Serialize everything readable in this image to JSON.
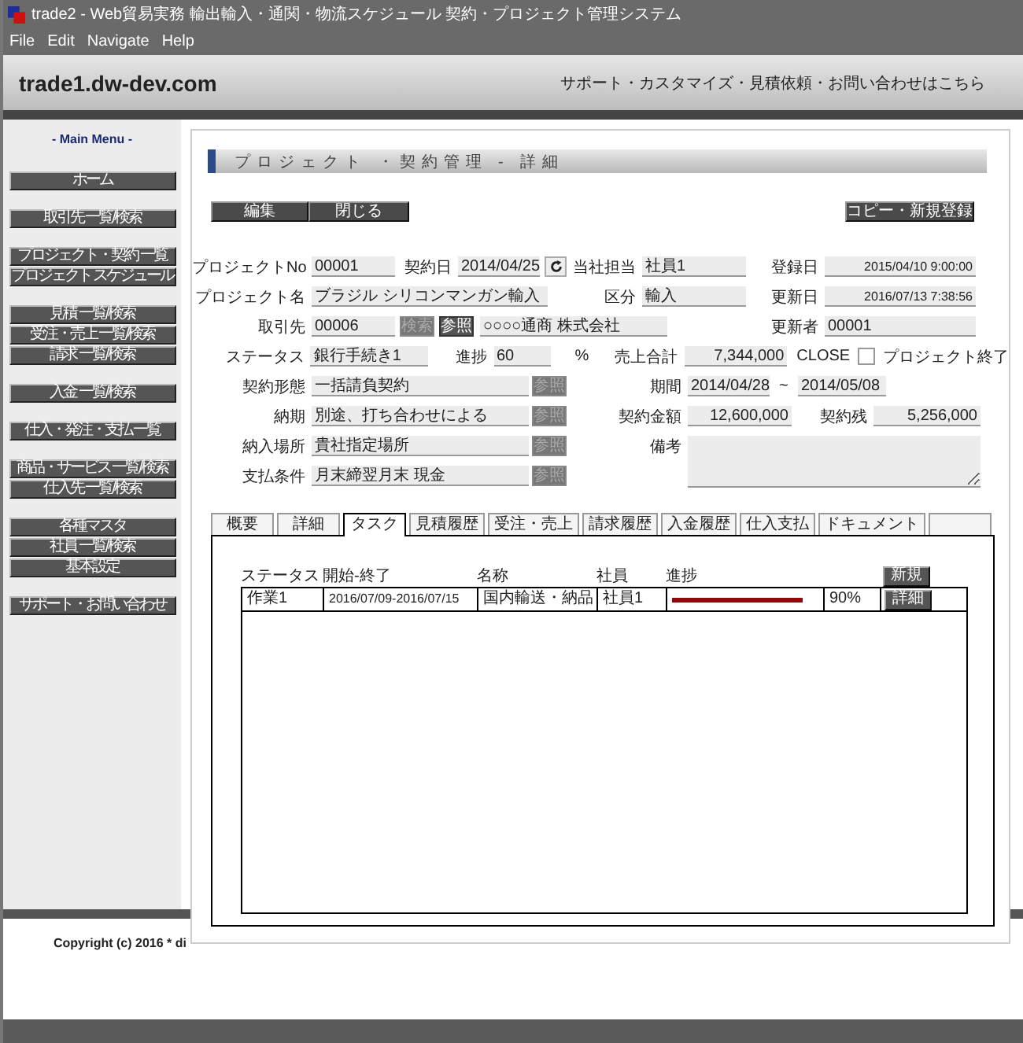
{
  "window": {
    "title": "trade2 - Web貿易実務 輸出輸入・通関・物流スケジュール 契約・プロジェクト管理システム"
  },
  "menu": [
    "File",
    "Edit",
    "Navigate",
    "Help"
  ],
  "header": {
    "site": "trade1.dw-dev.com",
    "link": "サポート・カスタマイズ・見積依頼・お問い合わせはこちら"
  },
  "sidebar": {
    "title": "- Main Menu -",
    "groups": [
      [
        "ホーム"
      ],
      [
        "取引先 一覧/検索"
      ],
      [
        "プロジェクト・契約 一覧",
        "プロジェクト スケジュール"
      ],
      [
        "見積 一覧/検索",
        "受注・売上 一覧/検索",
        "請求 一覧/検索"
      ],
      [
        "入金 一覧/検索"
      ],
      [
        "仕入・発注・支払 一覧"
      ],
      [
        "商品・サービス 一覧/検索",
        "仕入先 一覧/検索"
      ],
      [
        "各種マスタ",
        "社員 一覧/検索",
        "基本設定"
      ],
      [
        "サポート・お問い合わせ"
      ]
    ]
  },
  "section_title": "プロジェクト ・契約管理 - 詳細",
  "actions": {
    "edit": "編集",
    "close": "閉じる",
    "copy": "コピー・新規登録"
  },
  "form": {
    "project_no": {
      "label": "プロジェクトNo",
      "value": "00001"
    },
    "contract_date": {
      "label": "契約日",
      "value": "2014/04/25"
    },
    "our_staff": {
      "label": "当社担当",
      "value": "社員1"
    },
    "registered": {
      "label": "登録日",
      "value": "2015/04/10 9:00:00"
    },
    "project_name": {
      "label": "プロジェクト名",
      "value": "ブラジル シリコンマンガン輸入"
    },
    "category": {
      "label": "区分",
      "value": "輸入"
    },
    "updated": {
      "label": "更新日",
      "value": "2016/07/13 7:38:56"
    },
    "client": {
      "label": "取引先",
      "code": "00006",
      "search_button": {
        "label": "検索",
        "disabled": true
      },
      "ref_button": {
        "label": "参照",
        "disabled": false
      },
      "name": "○○○○通商 株式会社"
    },
    "updater": {
      "label": "更新者",
      "value": "00001"
    },
    "status": {
      "label": "ステータス",
      "value": "銀行手続き1"
    },
    "progress": {
      "label": "進捗",
      "value": "60",
      "unit": "%"
    },
    "sales_total": {
      "label": "売上合計",
      "value": "7,344,000"
    },
    "close": {
      "label": "CLOSE",
      "checked": false,
      "caption": "プロジェクト終了"
    },
    "contract_type": {
      "label": "契約形態",
      "value": "一括請負契約",
      "ref_button": {
        "label": "参照",
        "disabled": true
      }
    },
    "period": {
      "label": "期間",
      "from": "2014/04/28",
      "separator": "~",
      "to": "2014/05/08"
    },
    "delivery": {
      "label": "納期",
      "value": "別途、打ち合わせによる",
      "ref_button": {
        "label": "参照",
        "disabled": true
      }
    },
    "contract_amount": {
      "label": "契約金額",
      "value": "12,600,000"
    },
    "balance": {
      "label": "契約残",
      "value": "5,256,000"
    },
    "place": {
      "label": "納入場所",
      "value": "貴社指定場所",
      "ref_button": {
        "label": "参照",
        "disabled": true
      }
    },
    "remarks": {
      "label": "備考"
    },
    "payment": {
      "label": "支払条件",
      "value": "月末締翌月末 現金",
      "ref_button": {
        "label": "参照",
        "disabled": true
      }
    }
  },
  "tabs": [
    {
      "label": "概要",
      "selected": false
    },
    {
      "label": "詳細",
      "selected": false
    },
    {
      "label": "タスク",
      "selected": true
    },
    {
      "label": "見積履歴",
      "selected": false
    },
    {
      "label": "受注・売上",
      "selected": false
    },
    {
      "label": "請求履歴",
      "selected": false
    },
    {
      "label": "入金履歴",
      "selected": false
    },
    {
      "label": "仕入支払",
      "selected": false
    },
    {
      "label": "ドキュメント",
      "selected": false
    }
  ],
  "tasks": {
    "columns": [
      "ステータス",
      "開始-終了",
      "名称",
      "社員",
      "進捗"
    ],
    "new_button": "新規",
    "rows": [
      {
        "status": "作業1",
        "period": "2016/07/09-2016/07/15",
        "name": "国内輸送・納品",
        "staff": "社員1",
        "level": 0.9,
        "progress": "90%",
        "detail_button": "詳細"
      }
    ]
  },
  "footer": {
    "copyright": "Copyright (c) 2016 * di"
  }
}
